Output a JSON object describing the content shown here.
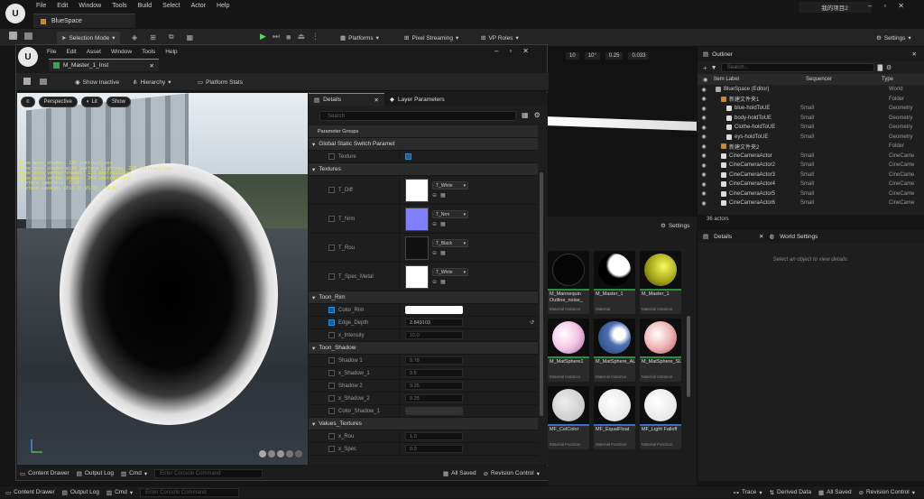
{
  "app": {
    "title": "BlueSpace",
    "project": "我的项目2",
    "menu": [
      "File",
      "Edit",
      "Window",
      "Tools",
      "Build",
      "Select",
      "Actor",
      "Help"
    ]
  },
  "toolbar": {
    "selection_mode": "Selection Mode",
    "platforms": "Platforms",
    "pixel_streaming": "Pixel Streaming",
    "vp_roles": "VP Roles",
    "settings": "Settings"
  },
  "viewport_stats": {
    "snap": "10",
    "angle": "10°",
    "scale": "0.25",
    "speed": "0.033"
  },
  "editor": {
    "menu": [
      "File",
      "Edit",
      "Asset",
      "Window",
      "Tools",
      "Help"
    ],
    "tab": "M_Master_1_Inst",
    "show_inactive": "Show Inactive",
    "hierarchy": "Hierarchy",
    "platform_stats": "Platform Stats"
  },
  "viewport": {
    "perspective": "Perspective",
    "lit": "Lit",
    "show": "Show",
    "stats": [
      "Base pass shader: 182 instructions",
      "Base pass shader with Surface Lightmap: 218 instructions",
      "Base pass vertex shader: 122 instructions",
      "Base pass vertex shader: 204 instructions",
      "Texture samplers: 7/16",
      "Texture Lookups (Est.): VS(0), PS(4)"
    ]
  },
  "details": {
    "tab": "Details",
    "layer_tab": "Layer Parameters",
    "search_placeholder": "Search",
    "param_groups": "Parameter Groups",
    "static_switch": "Global Static Switch Paramet",
    "texture_label": "Texture",
    "textures_section": "Textures",
    "textures": [
      {
        "label": "T_Diff",
        "value": "T_White",
        "color": "#ffffff"
      },
      {
        "label": "T_Nrm",
        "value": "T_Nrm",
        "color": "#8080ff"
      },
      {
        "label": "T_Rou",
        "value": "T_Black",
        "color": "#111111"
      },
      {
        "label": "T_Spec_Metal",
        "value": "T_White",
        "color": "#ffffff"
      }
    ],
    "toon_rim": "Toon_Rim",
    "color_rim": "Color_Rim",
    "edge_depth": "Edge_Depth",
    "edge_depth_value": "2.849103",
    "x_intensity": "x_Intensity",
    "x_intensity_value": "10.0",
    "toon_shadow": "Toon_Shadow",
    "shadow_rows": [
      {
        "label": "Shadow 1",
        "value": "0.78"
      },
      {
        "label": "x_Shadow_1",
        "value": "0.5"
      },
      {
        "label": "Shadow 2",
        "value": "0.25"
      },
      {
        "label": "x_Shadow_2",
        "value": "0.25"
      }
    ],
    "color_shadow": "Color_Shadow_1",
    "values_textures": "Values_Textures",
    "value_rows": [
      {
        "label": "x_Rou",
        "value": "1.0"
      },
      {
        "label": "x_Spec",
        "value": "0.0"
      }
    ]
  },
  "outliner": {
    "title": "Outliner",
    "search_placeholder": "Search...",
    "col_label": "Item Label",
    "col_sequencer": "Sequencer",
    "col_type": "Type",
    "rows": [
      {
        "label": "BlueSpace (Editor)",
        "seq": "",
        "type": "World",
        "indent": 1
      },
      {
        "label": "新建文件夹1",
        "seq": "",
        "type": "Folder",
        "indent": 2
      },
      {
        "label": "blue-holdToUE",
        "seq": "Small",
        "type": "Geometry",
        "indent": 3
      },
      {
        "label": "body-holdToUE",
        "seq": "Small",
        "type": "Geometry",
        "indent": 3
      },
      {
        "label": "Clothe-holdToUE",
        "seq": "Small",
        "type": "Geometry",
        "indent": 3
      },
      {
        "label": "eys-holdToUE",
        "seq": "Small",
        "type": "Geometry",
        "indent": 3
      },
      {
        "label": "新建文件夹2",
        "seq": "",
        "type": "Folder",
        "indent": 2
      },
      {
        "label": "CineCameraActor",
        "seq": "Small",
        "type": "CineCame",
        "indent": 2
      },
      {
        "label": "CineCameraActor2",
        "seq": "Small",
        "type": "CineCame",
        "indent": 2
      },
      {
        "label": "CineCameraActor3",
        "seq": "Small",
        "type": "CineCame",
        "indent": 2
      },
      {
        "label": "CineCameraActor4",
        "seq": "Small",
        "type": "CineCame",
        "indent": 2
      },
      {
        "label": "CineCameraActor5",
        "seq": "Small",
        "type": "CineCame",
        "indent": 2
      },
      {
        "label": "CineCameraActor6",
        "seq": "Small",
        "type": "CineCame",
        "indent": 2
      }
    ],
    "actors": "36 actors"
  },
  "right_details": {
    "tab": "Details",
    "world_settings": "World Settings",
    "empty": "Select an object to view details."
  },
  "content": {
    "settings": "Settings",
    "assets": [
      {
        "name": "M_Mannequin Outline_noise_",
        "type": "Material Instance"
      },
      {
        "name": "M_Master_1",
        "type": "Material"
      },
      {
        "name": "M_Master_1",
        "type": "Material Instance"
      },
      {
        "name": "M_MatSphere1",
        "type": "Material Instance"
      },
      {
        "name": "M_MatSphere_AL",
        "type": "Material Instance"
      },
      {
        "name": "M_MatSphere_SL",
        "type": "Material Instance"
      },
      {
        "name": "MF_CelColor",
        "type": "Material Function"
      },
      {
        "name": "MF_EqualFloat",
        "type": "Material Function"
      },
      {
        "name": "MF_Light Falloff",
        "type": "Material Function"
      }
    ]
  },
  "bottom": {
    "content_drawer": "Content Drawer",
    "output_log": "Output Log",
    "cmd": "Cmd",
    "console_placeholder": "Enter Console Command",
    "all_saved": "All Saved",
    "revision_control": "Revision Control",
    "trace": "Trace",
    "derived_data": "Derived Data"
  }
}
